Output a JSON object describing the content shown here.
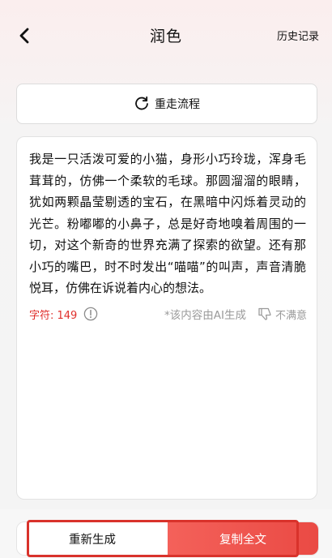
{
  "header": {
    "title": "润色",
    "history_label": "历史记录",
    "back_icon": "chevron-left-icon"
  },
  "restart": {
    "label": "重走流程",
    "icon": "refresh-icon"
  },
  "content": {
    "text": "我是一只活泼可爱的小猫，身形小巧玲珑，浑身毛茸茸的，仿佛一个柔软的毛球。那圆溜溜的眼睛，犹如两颗晶莹剔透的宝石，在黑暗中闪烁着灵动的光芒。粉嘟嘟的小鼻子，总是好奇地嗅着周围的一切，对这个新奇的世界充满了探索的欲望。还有那小巧的嘴巴，时不时发出“喵喵”的叫声，声音清脆悦耳，仿佛在诉说着内心的想法。",
    "char_count_label": "字符: 149",
    "ai_note": "*该内容由AI生成",
    "dislike_label": "不满意"
  },
  "actions": {
    "regenerate_label": "重新生成",
    "copy_label": "复制全文"
  },
  "colors": {
    "accent": "#ea4a44",
    "count_red": "#e0302c",
    "muted": "#9a9a9a",
    "highlight": "#d9322b"
  }
}
